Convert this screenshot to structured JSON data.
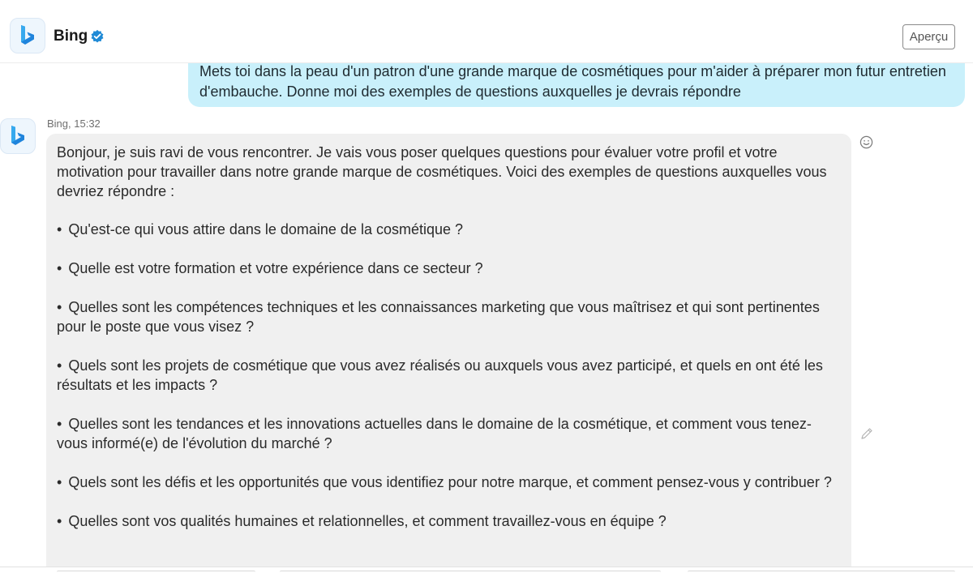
{
  "header": {
    "name": "Bing",
    "apercu_label": "Aperçu"
  },
  "colors": {
    "user_bubble": "#c9f0fb",
    "bot_bubble": "#f0f0f0",
    "verified_badge": "#1f8ad6",
    "bing_logo_light": "#59c2f5",
    "bing_logo_dark": "#1570d6"
  },
  "user_message": {
    "text": "Mets toi dans la peau d'un patron d'une grande marque de cosmétiques pour m'aider à préparer mon futur entretien d'embauche. Donne moi des exemples de questions auxquelles je devrais répondre"
  },
  "bot_message": {
    "meta": "Bing, 15:32",
    "intro": "Bonjour, je suis ravi de vous rencontrer. Je vais vous poser quelques questions pour évaluer votre profil et votre motivation pour travailler dans notre grande marque de cosmétiques. Voici des exemples de questions auxquelles vous devriez répondre :",
    "bullet_char": "•",
    "questions": [
      "Qu'est-ce qui vous attire dans le domaine de la cosmétique ?",
      "Quelle est votre formation et votre expérience dans ce secteur ?",
      "Quelles sont les compétences techniques et les connaissances marketing que vous maîtrisez et qui sont pertinentes pour le poste que vous visez ?",
      "Quels sont les projets de cosmétique que vous avez réalisés ou auxquels vous avez participé, et quels en ont été les résultats et les impacts ?",
      "Quelles sont les tendances et les innovations actuelles dans le domaine de la cosmétique, et comment vous tenez-vous informé(e) de l'évolution du marché ?",
      "Quels sont les défis et les opportunités que vous identifiez pour notre marque, et comment pensez-vous y contribuer ?",
      "Quelles sont vos qualités humaines et relationnelles, et comment travaillez-vous en équipe ?"
    ]
  },
  "icons": {
    "header_logo": "bing-logo-icon",
    "verified": "verified-badge-icon",
    "bot_logo": "bing-logo-icon",
    "reaction": "smile-icon",
    "edit": "pencil-icon"
  }
}
